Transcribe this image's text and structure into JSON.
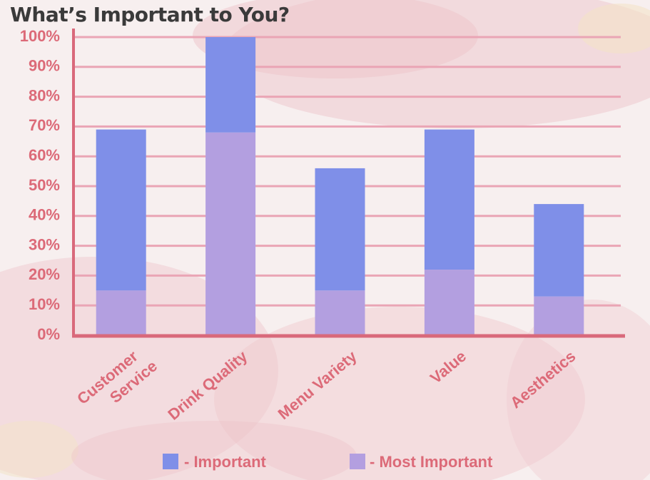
{
  "title": "What’s Important to You?",
  "colors": {
    "important": "#7f8fe8",
    "most_important": "#b39fe0",
    "axis": "#d9697b",
    "grid": "#eaa5b5",
    "label": "#dc6a78"
  },
  "legend": {
    "important_label": "- Important",
    "most_important_label": "- Most Important"
  },
  "chart_data": {
    "type": "bar",
    "stacked": true,
    "categories": [
      "Customer Service",
      "Drink Quality",
      "Menu Variety",
      "Value",
      "Aesthetics"
    ],
    "category_label_lines": [
      [
        "Customer",
        "Service"
      ],
      [
        "Drink Quality"
      ],
      [
        "Menu Variety"
      ],
      [
        "Value"
      ],
      [
        "Aesthetics"
      ]
    ],
    "series": [
      {
        "name": "- Most Important",
        "values": [
          15,
          68,
          15,
          22,
          13
        ]
      },
      {
        "name": "- Important",
        "values": [
          54,
          32,
          41,
          47,
          31
        ]
      }
    ],
    "ylim": [
      0,
      100
    ],
    "yticks": [
      "0%",
      "10%",
      "20%",
      "30%",
      "40%",
      "50%",
      "60%",
      "70%",
      "80%",
      "90%",
      "100%"
    ],
    "grid": true,
    "legend_position": "bottom",
    "xlabel": "",
    "ylabel": ""
  }
}
